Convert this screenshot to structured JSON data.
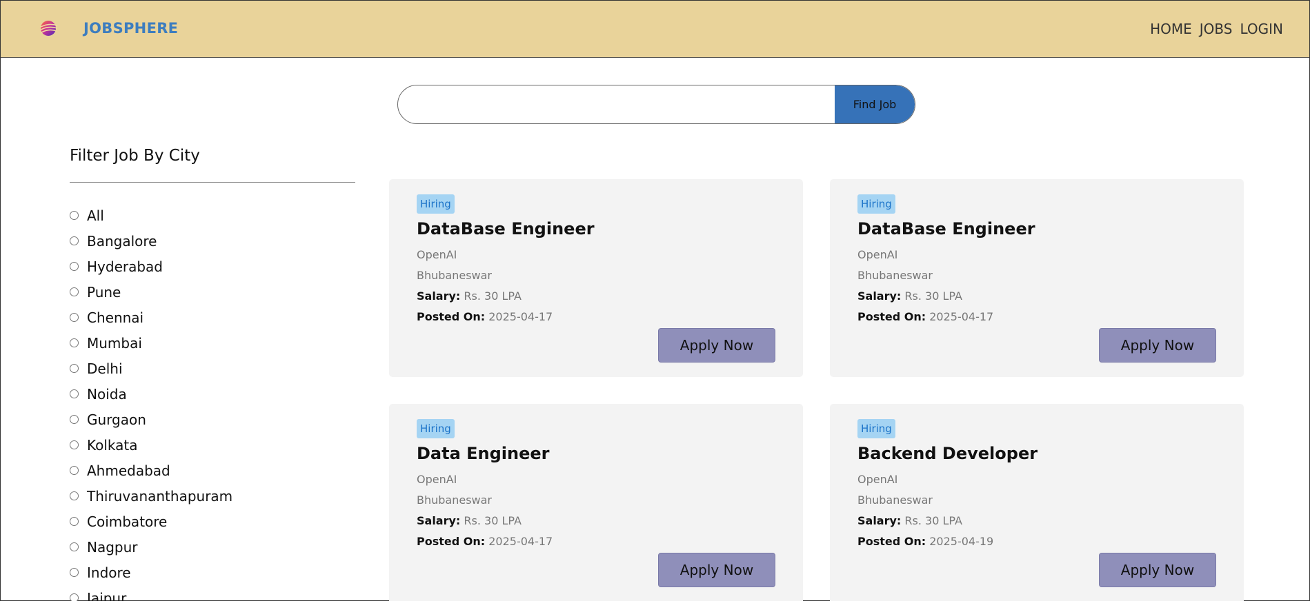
{
  "navbar": {
    "brand": "JOBSPHERE",
    "links": [
      "HOME",
      "JOBS",
      "LOGIN"
    ]
  },
  "search": {
    "value": "",
    "placeholder": "",
    "button_label": "Find Job"
  },
  "filter": {
    "title": "Filter Job By City",
    "cities": [
      "All",
      "Bangalore",
      "Hyderabad",
      "Pune",
      "Chennai",
      "Mumbai",
      "Delhi",
      "Noida",
      "Gurgaon",
      "Kolkata",
      "Ahmedabad",
      "Thiruvananthapuram",
      "Coimbatore",
      "Nagpur",
      "Indore",
      "Jaipur"
    ]
  },
  "labels": {
    "salary": "Salary:",
    "posted_on": "Posted On:"
  },
  "jobs": [
    {
      "badge": "Hiring",
      "title": "DataBase Engineer",
      "company": "OpenAI",
      "location": "Bhubaneswar",
      "salary": "Rs. 30 LPA",
      "posted_on": "2025-04-17",
      "apply_label": "Apply Now"
    },
    {
      "badge": "Hiring",
      "title": "DataBase Engineer",
      "company": "OpenAI",
      "location": "Bhubaneswar",
      "salary": "Rs. 30 LPA",
      "posted_on": "2025-04-17",
      "apply_label": "Apply Now"
    },
    {
      "badge": "Hiring",
      "title": "Data Engineer",
      "company": "OpenAI",
      "location": "Bhubaneswar",
      "salary": "Rs. 30 LPA",
      "posted_on": "2025-04-17",
      "apply_label": "Apply Now"
    },
    {
      "badge": "Hiring",
      "title": "Backend Developer",
      "company": "OpenAI",
      "location": "Bhubaneswar",
      "salary": "Rs. 30 LPA",
      "posted_on": "2025-04-19",
      "apply_label": "Apply Now"
    }
  ],
  "colors": {
    "navbar_bg": "#e9d39a",
    "brand": "#3d7dbf",
    "search_button": "#3672b8",
    "apply_button": "#8f8fba",
    "badge_bg": "#a5d4f3",
    "badge_text": "#1d74c9"
  }
}
